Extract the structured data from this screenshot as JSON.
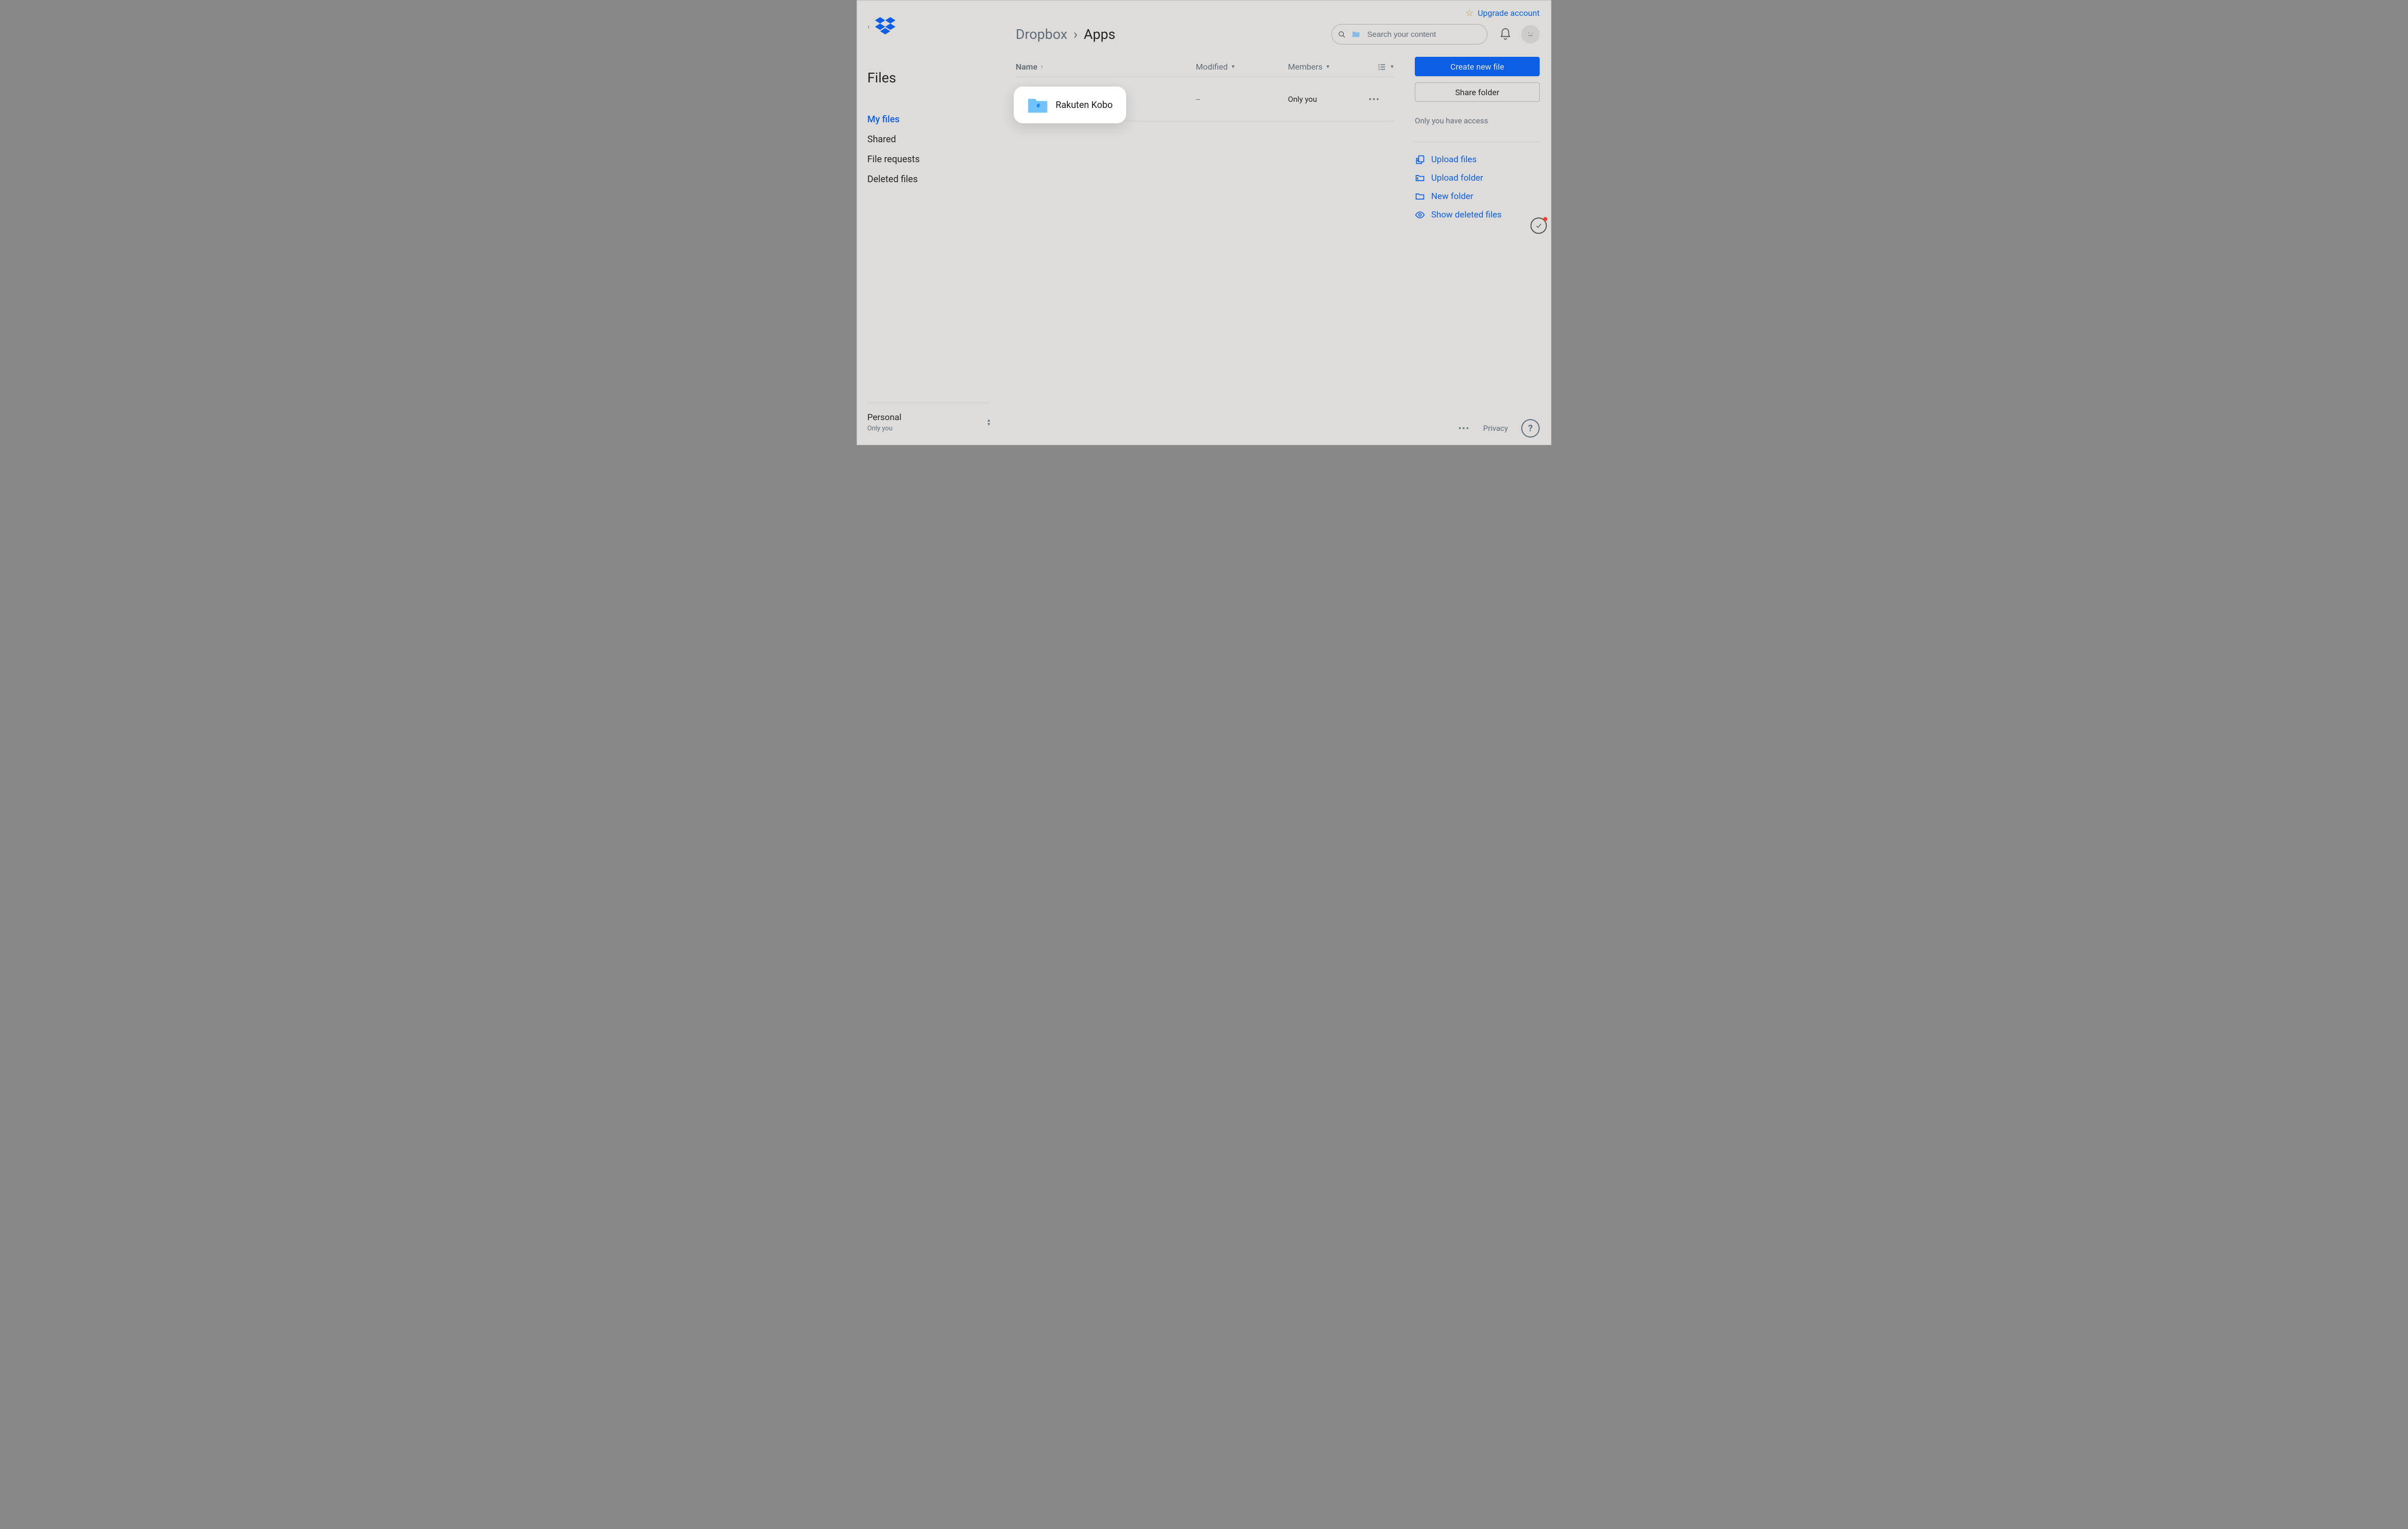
{
  "upgrade": {
    "label": "Upgrade account"
  },
  "sidebar": {
    "heading": "Files",
    "items": [
      "My files",
      "Shared",
      "File requests",
      "Deleted files"
    ],
    "active_index": 0,
    "account": {
      "label": "Personal",
      "sub": "Only you"
    }
  },
  "breadcrumb": {
    "root": "Dropbox",
    "sep": "›",
    "current": "Apps"
  },
  "search": {
    "placeholder": "Search your content"
  },
  "columns": {
    "name": "Name",
    "modified": "Modified",
    "members": "Members"
  },
  "rows": [
    {
      "name": "Rakuten Kobo",
      "modified": "--",
      "members": "Only you"
    }
  ],
  "highlight": {
    "name": "Rakuten Kobo"
  },
  "right": {
    "create": "Create new file",
    "share": "Share folder",
    "access": "Only you have access",
    "actions": [
      "Upload files",
      "Upload folder",
      "New folder",
      "Show deleted files"
    ]
  },
  "footer": {
    "privacy": "Privacy",
    "help": "?"
  }
}
